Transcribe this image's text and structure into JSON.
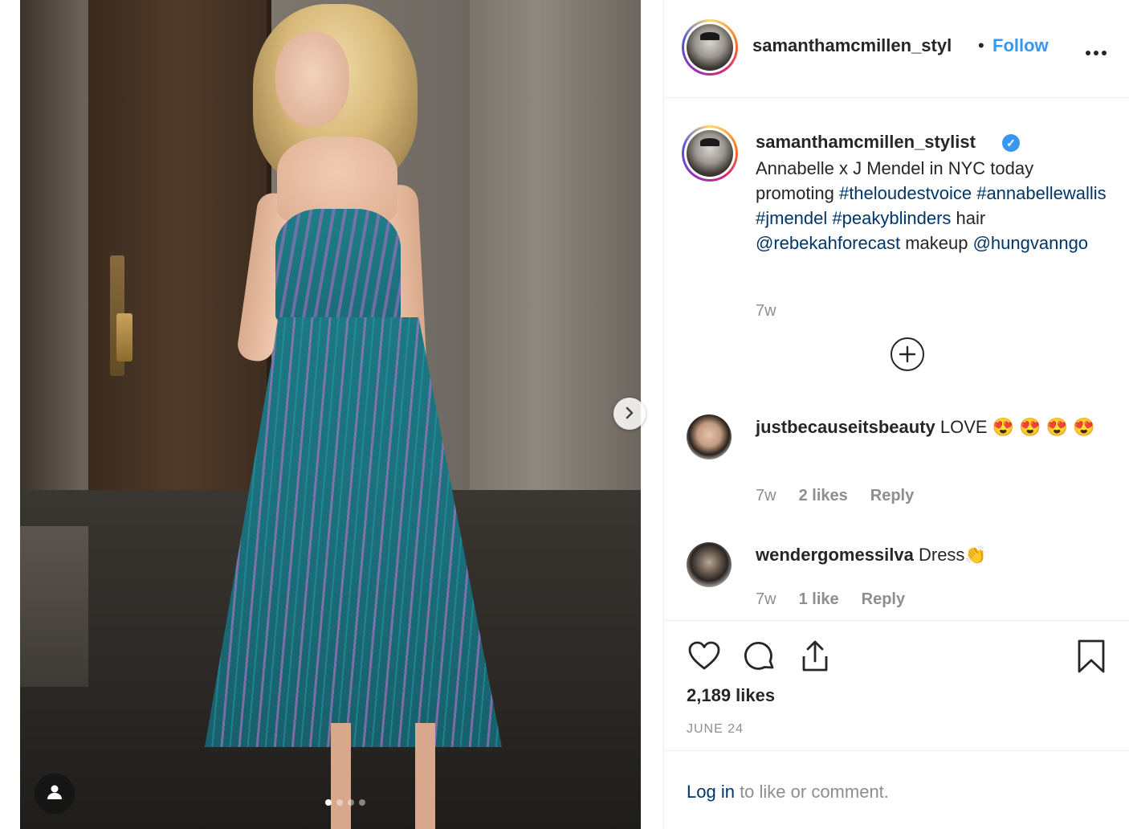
{
  "photo": {
    "carousel_dots": 4,
    "active_dot": 0
  },
  "post": {
    "author": "samanthamcmillen_stylist",
    "author_truncated": "samanthamcmillen_styl",
    "separator": "•",
    "follow_label": "Follow",
    "more_label": "•••"
  },
  "caption": {
    "username": "samanthamcmillen_stylist",
    "verified_glyph": "✓",
    "segments": [
      {
        "text": "Annabelle x J Mendel in NYC today promoting ",
        "link": false
      },
      {
        "text": "#theloudestvoice",
        "link": true
      },
      {
        "text": " ",
        "link": false
      },
      {
        "text": "#annabellewallis",
        "link": true
      },
      {
        "text": " ",
        "link": false
      },
      {
        "text": "#jmendel",
        "link": true
      },
      {
        "text": " ",
        "link": false
      },
      {
        "text": "#peakyblinders",
        "link": true
      },
      {
        "text": " hair ",
        "link": false
      },
      {
        "text": "@rebekahforecast",
        "link": true
      },
      {
        "text": " makeup ",
        "link": false
      },
      {
        "text": "@hungvanngo",
        "link": true
      }
    ],
    "time": "7w"
  },
  "load_more_label": "+",
  "comments": [
    {
      "username": "justbecauseitsbeauty",
      "text": " LOVE 😍 😍 😍 😍",
      "time": "7w",
      "likes": "2 likes",
      "reply": "Reply"
    },
    {
      "username": "wendergomessilva",
      "text": " Dress👏",
      "time": "7w",
      "likes": "1 like",
      "reply": "Reply"
    }
  ],
  "actions": {
    "like_icon": "heart-icon",
    "comment_icon": "comment-icon",
    "share_icon": "share-icon",
    "save_icon": "bookmark-icon"
  },
  "likes": "2,189 likes",
  "date": "JUNE 24",
  "login": {
    "link_text": "Log in",
    "rest_text": " to like or comment."
  },
  "colors": {
    "link_blue": "#003569",
    "follow_blue": "#3897f0",
    "muted": "#8e8e8e",
    "text": "#262626"
  }
}
